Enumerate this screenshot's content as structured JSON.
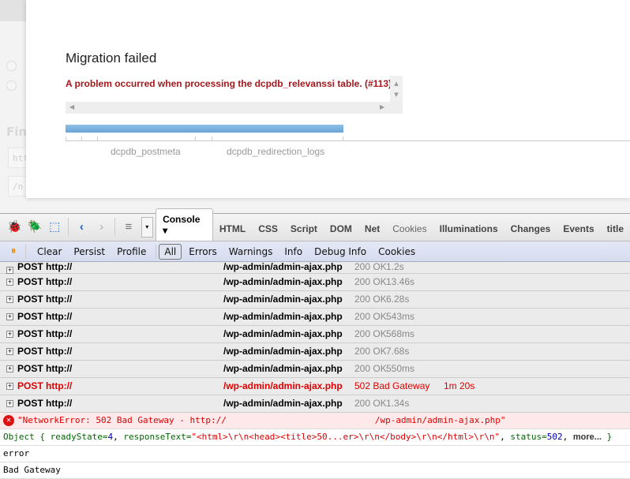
{
  "background": {
    "find_label": "Fin",
    "input1": "htt",
    "input2": "/n"
  },
  "dialog": {
    "title": "Migration failed",
    "error_message": "A problem occurred when processing the dcpdb_relevanssi table. (#113)",
    "progress_labels": [
      "dcpdb_postmeta",
      "dcpdb_redirection_logs"
    ],
    "progress_color": "#7ab2e0"
  },
  "firebug": {
    "toolbar_icons": [
      "firebug-icon",
      "inspect-bug-icon",
      "inspect-element-icon",
      "back-icon",
      "forward-icon",
      "list-icon"
    ],
    "tabs": [
      {
        "label": "Console ▾",
        "active": true
      },
      {
        "label": "HTML"
      },
      {
        "label": "CSS"
      },
      {
        "label": "Script"
      },
      {
        "label": "DOM"
      },
      {
        "label": "Net"
      },
      {
        "label": "Cookies"
      },
      {
        "label": "Illuminations"
      },
      {
        "label": "Changes"
      },
      {
        "label": "Events"
      },
      {
        "label": "title"
      }
    ],
    "filters": [
      {
        "label": "Clear"
      },
      {
        "label": "Persist"
      },
      {
        "label": "Profile"
      },
      {
        "label": "All",
        "active": true
      },
      {
        "label": "Errors"
      },
      {
        "label": "Warnings"
      },
      {
        "label": "Info"
      },
      {
        "label": "Debug Info"
      },
      {
        "label": "Cookies"
      }
    ],
    "requests": [
      {
        "method": "POST http://",
        "url": "/wp-admin/admin-ajax.php",
        "status": "200 OK",
        "time": "1.2s"
      },
      {
        "method": "POST http://",
        "url": "/wp-admin/admin-ajax.php",
        "status": "200 OK",
        "time": "13.46s"
      },
      {
        "method": "POST http://",
        "url": "/wp-admin/admin-ajax.php",
        "status": "200 OK",
        "time": "6.28s"
      },
      {
        "method": "POST http://",
        "url": "/wp-admin/admin-ajax.php",
        "status": "200 OK",
        "time": "543ms"
      },
      {
        "method": "POST http://",
        "url": "/wp-admin/admin-ajax.php",
        "status": "200 OK",
        "time": "568ms"
      },
      {
        "method": "POST http://",
        "url": "/wp-admin/admin-ajax.php",
        "status": "200 OK",
        "time": "7.68s"
      },
      {
        "method": "POST http://",
        "url": "/wp-admin/admin-ajax.php",
        "status": "200 OK",
        "time": "550ms"
      },
      {
        "method": "POST http://",
        "url": "/wp-admin/admin-ajax.php",
        "status": "502 Bad Gateway",
        "time": "1m 20s",
        "error": true
      },
      {
        "method": "POST http://",
        "url": "/wp-admin/admin-ajax.php",
        "status": "200 OK",
        "time": "1.34s"
      }
    ],
    "network_error": {
      "text_a": "\"NetworkError: 502 Bad Gateway - http://",
      "text_b": "/wp-admin/admin-ajax.php\""
    },
    "object_line": {
      "prefix": "Object {",
      "k1": "readyState=",
      "v1": "4",
      "sep": ",",
      "k2": "responseText=",
      "v2": "\"<html>\\r\\n<head><title>50...er>\\r\\n</body>\\r\\n</html>\\r\\n\"",
      "k3": "status=",
      "v3": "502",
      "more": "more...",
      "suffix": "}"
    },
    "log_lines": [
      "error",
      "Bad Gateway"
    ],
    "error_color": "#e00000"
  }
}
